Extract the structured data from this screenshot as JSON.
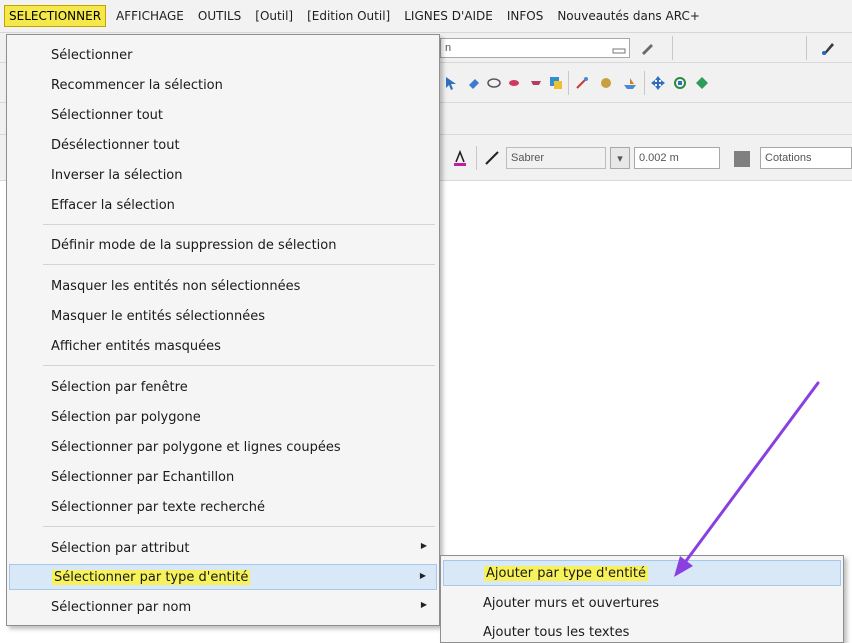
{
  "menubar": {
    "items": [
      {
        "label": "SELECTIONNER",
        "active": true
      },
      {
        "label": "AFFICHAGE",
        "active": false
      },
      {
        "label": "OUTILS",
        "active": false
      },
      {
        "label": "[Outil]",
        "active": false
      },
      {
        "label": "[Edition Outil]",
        "active": false
      },
      {
        "label": "LIGNES D'AIDE",
        "active": false
      },
      {
        "label": "INFOS",
        "active": false
      },
      {
        "label": "Nouveautés dans ARC+",
        "active": false
      }
    ]
  },
  "toolbar": {
    "view_field_text": "n",
    "linetype_value": "Sabrer",
    "width_value": "0.002 m",
    "layer_value": "Cotations"
  },
  "menu": {
    "items": [
      {
        "label": "Sélectionner"
      },
      {
        "label": "Recommencer la sélection"
      },
      {
        "label": "Sélectionner tout"
      },
      {
        "label": "Désélectionner tout"
      },
      {
        "label": "Inverser la sélection"
      },
      {
        "label": "Effacer la sélection"
      },
      {
        "label": "Définir mode de la suppression de sélection"
      },
      {
        "label": "Masquer les entités non sélectionnées"
      },
      {
        "label": "Masquer le entités sélectionnées"
      },
      {
        "label": "Afficher entités masquées"
      },
      {
        "label": "Sélection par fenêtre"
      },
      {
        "label": "Sélection par polygone"
      },
      {
        "label": "Sélectionner par polygone et lignes coupées"
      },
      {
        "label": "Sélectionner par Echantillon"
      },
      {
        "label": "Sélectionner par texte recherché"
      },
      {
        "label": "Sélection par attribut",
        "submenu": true
      },
      {
        "label": "Sélectionner par type d'entité",
        "submenu": true,
        "highlighted": true
      },
      {
        "label": "Sélectionner par nom",
        "submenu": true
      }
    ]
  },
  "submenu": {
    "items": [
      {
        "label": "Ajouter par type d'entité",
        "highlighted": true
      },
      {
        "label": "Ajouter murs et ouvertures"
      },
      {
        "label": "Ajouter tous les textes"
      }
    ]
  },
  "colors": {
    "highlight_yellow": "#f8f25a",
    "hover_blue": "#d9e8f7",
    "annotation_arrow": "#8a3fe0"
  },
  "icons": [
    "pencil-icon",
    "marker-icon",
    "select-arrow-icon",
    "eraser-icon",
    "copy-icon",
    "move-icon",
    "text-color-icon",
    "line-style-icon",
    "layer-color-icon"
  ]
}
